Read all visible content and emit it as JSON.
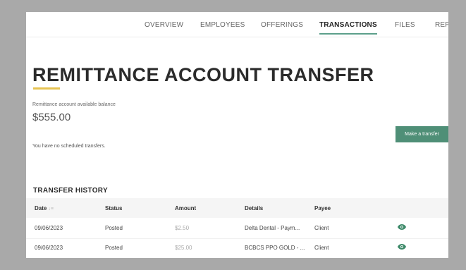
{
  "nav": {
    "tabs": [
      {
        "label": "OVERVIEW"
      },
      {
        "label": "EMPLOYEES"
      },
      {
        "label": "OFFERINGS"
      },
      {
        "label": "TRANSACTIONS",
        "active": true
      },
      {
        "label": "FILES"
      },
      {
        "label": "REPO"
      }
    ]
  },
  "page": {
    "title": "REMITTANCE ACCOUNT TRANSFER",
    "balance_label": "Remittance account available balance",
    "balance_amount": "$555.00",
    "transfer_button": "Make a transfer",
    "scheduled_text": "You have no scheduled transfers."
  },
  "history": {
    "title": "TRANSFER HISTORY",
    "columns": [
      "Date",
      "Status",
      "Amount",
      "Details",
      "Payee"
    ],
    "rows": [
      {
        "date": "09/06/2023",
        "status": "Posted",
        "amount": "$2.50",
        "details": "Delta Dental - Paym...",
        "payee": "Client",
        "action_icon": "eye-icon"
      },
      {
        "date": "09/06/2023",
        "status": "Posted",
        "amount": "$25.00",
        "details": "BCBCS PPO GOLD - ...",
        "payee": "Client",
        "action_icon": "eye-icon"
      }
    ]
  },
  "colors": {
    "accent_green": "#4f8f77",
    "tab_underline": "#5c9f8a",
    "title_accent": "#e6c352",
    "eye_icon": "#3e8a6a"
  }
}
